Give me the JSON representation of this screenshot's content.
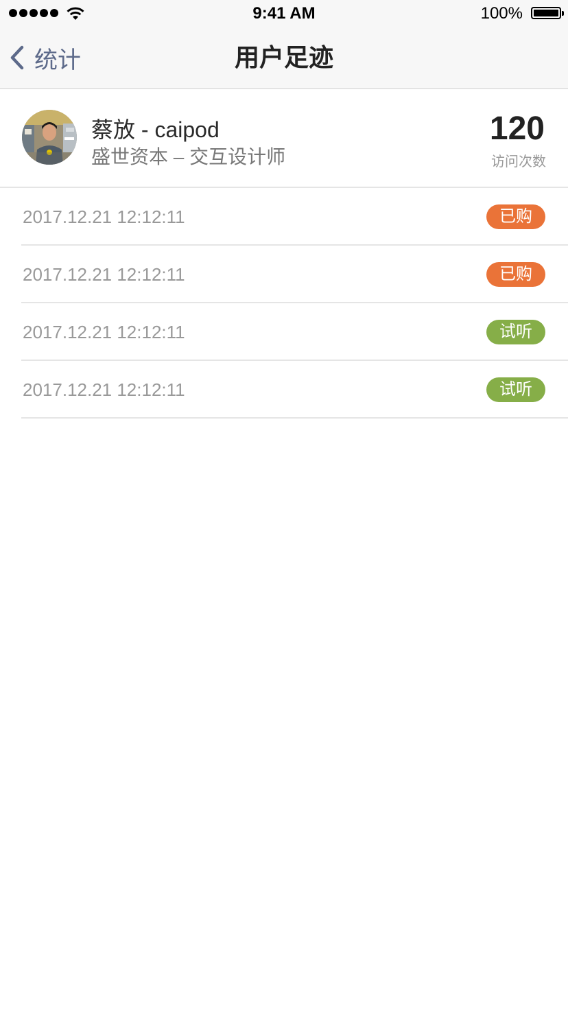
{
  "status_bar": {
    "time": "9:41 AM",
    "battery": "100%",
    "signal_icon": "signal-dots-icon",
    "wifi_icon": "wifi-icon",
    "battery_icon": "battery-icon"
  },
  "nav": {
    "back_label": "统计",
    "back_icon": "chevron-left-icon",
    "title": "用户足迹"
  },
  "profile": {
    "avatar_icon": "avatar-photo",
    "name": "蔡放 - caipod",
    "subtitle": "盛世资本 – 交互设计师",
    "visit_count": "120",
    "visit_label": "访问次数"
  },
  "records": [
    {
      "time": "2017.12.21 12:12:11",
      "tag": "已购",
      "tag_type": "purchased"
    },
    {
      "time": "2017.12.21 12:12:11",
      "tag": "已购",
      "tag_type": "purchased"
    },
    {
      "time": "2017.12.21 12:12:11",
      "tag": "试听",
      "tag_type": "trial"
    },
    {
      "time": "2017.12.21 12:12:11",
      "tag": "试听",
      "tag_type": "trial"
    }
  ],
  "colors": {
    "purchased": "#ea7338",
    "trial": "#86ae48",
    "back_accent": "#5d6a8a"
  }
}
